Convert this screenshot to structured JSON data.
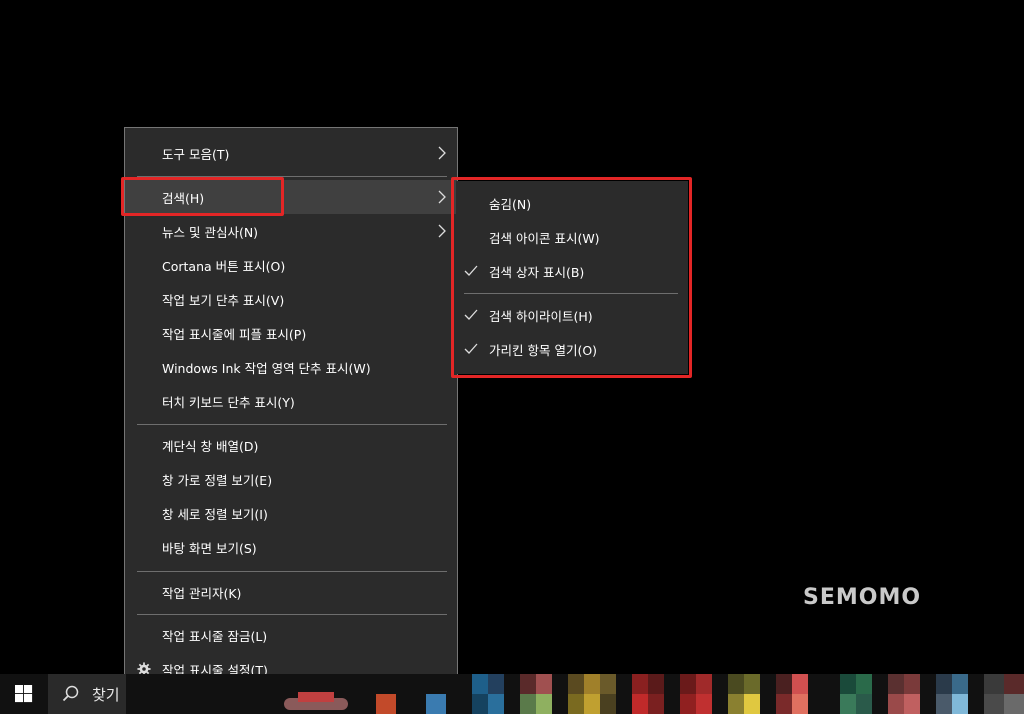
{
  "context_menu": {
    "items": [
      {
        "label": "도구 모음(T)",
        "submenu": true
      },
      {
        "label": "검색(H)",
        "submenu": true,
        "active": true
      },
      {
        "label": "뉴스 및 관심사(N)",
        "submenu": true
      },
      {
        "label": "Cortana 버튼 표시(O)"
      },
      {
        "label": "작업 보기 단추 표시(V)"
      },
      {
        "label": "작업 표시줄에 피플 표시(P)"
      },
      {
        "label": "Windows Ink 작업 영역 단추 표시(W)"
      },
      {
        "label": "터치 키보드 단추 표시(Y)"
      },
      {
        "label": "계단식 창 배열(D)"
      },
      {
        "label": "창 가로 정렬 보기(E)"
      },
      {
        "label": "창 세로 정렬 보기(I)"
      },
      {
        "label": "바탕 화면 보기(S)"
      },
      {
        "label": "작업 관리자(K)"
      },
      {
        "label": "작업 표시줄 잠금(L)"
      },
      {
        "label": "작업 표시줄 설정(T)",
        "icon": "gear-icon"
      }
    ]
  },
  "search_submenu": {
    "items": [
      {
        "label": "숨김(N)",
        "checked": false
      },
      {
        "label": "검색 아이콘 표시(W)",
        "checked": false
      },
      {
        "label": "검색 상자 표시(B)",
        "checked": true
      },
      {
        "label": "검색 하이라이트(H)",
        "checked": true
      },
      {
        "label": "가리킨 항목 열기(O)",
        "checked": true
      }
    ]
  },
  "taskbar": {
    "search_text": "찾기",
    "start_icon": "windows-logo-icon",
    "search_icon": "search-icon"
  },
  "watermark": "SEMOMO",
  "colors": {
    "menu_bg": "#2b2b2b",
    "hover_bg": "#404040",
    "highlight_border": "#e32626",
    "taskbar_bg": "#111111"
  }
}
